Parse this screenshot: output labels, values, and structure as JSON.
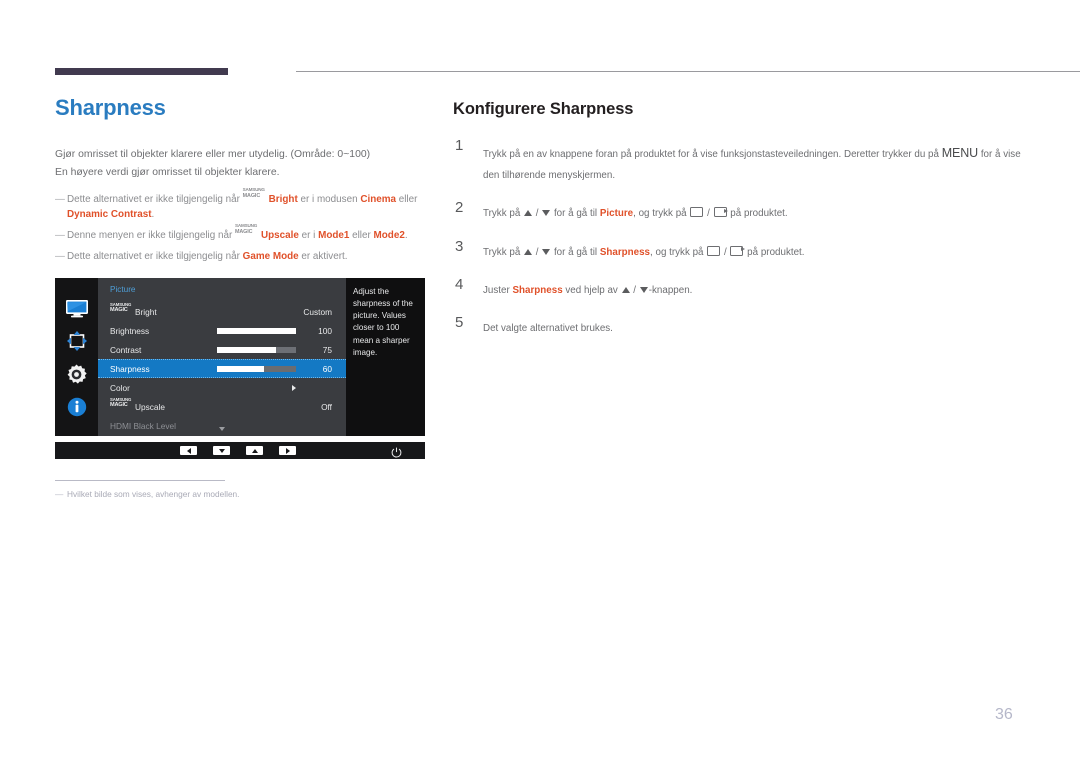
{
  "document": {
    "page_number": "36",
    "accent_blue": "#2a7cc0",
    "accent_orange": "#e0512a",
    "rule_color": "#413a4f"
  },
  "left": {
    "title": "Sharpness",
    "intro": [
      "Gjør omrisset til objekter klarere eller mer utydelig. (Område: 0~100)",
      "En høyere verdi gjør omrisset til objekter klarere."
    ],
    "notes": [
      {
        "dash": "—",
        "pre": "Dette alternativet er ikke tilgjengelig når ",
        "magic_top": "SAMSUNG",
        "magic_bottom": "MAGIC",
        "bold1": "Bright",
        "mid": " er i modusen ",
        "bold2": "Cinema",
        "mid2": " eller ",
        "bold3": "Dynamic Contrast",
        "post": "."
      },
      {
        "dash": "—",
        "pre": "Denne menyen er ikke tilgjengelig når ",
        "magic_top": "SAMSUNG",
        "magic_bottom": "MAGIC",
        "bold1": "Upscale",
        "mid": " er i ",
        "bold2": "Mode1",
        "mid2": " eller ",
        "bold3": "Mode2",
        "post": "."
      },
      {
        "dash": "—",
        "pre": "Dette alternativet er ikke tilgjengelig når ",
        "bold1": "Game Mode",
        "post": " er aktivert."
      }
    ],
    "footnote": {
      "dash": "—",
      "text": "Hvilket bilde som vises, avhenger av modellen."
    }
  },
  "osd": {
    "menu_title": "Picture",
    "side_icons": [
      {
        "name": "monitor-icon",
        "label": "Picture"
      },
      {
        "name": "resize-icon",
        "label": "OnScreen Display"
      },
      {
        "name": "gear-icon",
        "label": "System"
      },
      {
        "name": "info-icon",
        "label": "Information"
      }
    ],
    "rows": [
      {
        "label": "Bright",
        "magic_top": "SAMSUNG",
        "magic_bottom": "MAGIC",
        "has_magic": true,
        "value": "Custom",
        "type": "value",
        "selected": false,
        "disabled": false
      },
      {
        "label": "Brightness",
        "has_magic": false,
        "value": "100",
        "type": "slider",
        "fill_percent": 100,
        "selected": false,
        "disabled": false
      },
      {
        "label": "Contrast",
        "has_magic": false,
        "value": "75",
        "type": "slider",
        "fill_percent": 75,
        "selected": false,
        "disabled": false
      },
      {
        "label": "Sharpness",
        "has_magic": false,
        "value": "60",
        "type": "slider",
        "fill_percent": 60,
        "selected": true,
        "disabled": false
      },
      {
        "label": "Color",
        "has_magic": false,
        "value": "",
        "type": "submenu",
        "selected": false,
        "disabled": false
      },
      {
        "label": "Upscale",
        "magic_top": "SAMSUNG",
        "magic_bottom": "MAGIC",
        "has_magic": true,
        "value": "Off",
        "type": "value",
        "selected": false,
        "disabled": false
      },
      {
        "label": "HDMI Black Level",
        "has_magic": false,
        "value": "",
        "type": "value",
        "selected": false,
        "disabled": true
      }
    ],
    "help_text": "Adjust the sharpness of the picture. Values closer to 100 mean a sharper image.",
    "bottom_keys": [
      {
        "name": "key-left",
        "glyph": "left"
      },
      {
        "name": "key-down",
        "glyph": "down"
      },
      {
        "name": "key-up",
        "glyph": "up"
      },
      {
        "name": "key-right",
        "glyph": "right"
      },
      {
        "name": "key-power",
        "glyph": "power"
      }
    ]
  },
  "right": {
    "title": "Konfigurere Sharpness",
    "steps": [
      {
        "num": "1",
        "parts": [
          {
            "t": "text",
            "v": "Trykk på en av knappene foran på produktet for å vise funksjonstasteveiledningen. Deretter trykker du på "
          },
          {
            "t": "menu",
            "v": "MENU"
          },
          {
            "t": "text",
            "v": " for å vise den tilhørende menyskjermen."
          }
        ]
      },
      {
        "num": "2",
        "parts": [
          {
            "t": "text",
            "v": "Trykk på "
          },
          {
            "t": "icon",
            "v": "up"
          },
          {
            "t": "text",
            "v": " / "
          },
          {
            "t": "icon",
            "v": "down"
          },
          {
            "t": "text",
            "v": " for å gå til "
          },
          {
            "t": "bold",
            "v": "Picture"
          },
          {
            "t": "text",
            "v": ", og trykk på "
          },
          {
            "t": "icon",
            "v": "box"
          },
          {
            "t": "text",
            "v": " / "
          },
          {
            "t": "icon",
            "v": "enter"
          },
          {
            "t": "text",
            "v": " på produktet."
          }
        ]
      },
      {
        "num": "3",
        "parts": [
          {
            "t": "text",
            "v": "Trykk på "
          },
          {
            "t": "icon",
            "v": "up"
          },
          {
            "t": "text",
            "v": " / "
          },
          {
            "t": "icon",
            "v": "down"
          },
          {
            "t": "text",
            "v": " for å gå til "
          },
          {
            "t": "bold",
            "v": "Sharpness"
          },
          {
            "t": "text",
            "v": ", og trykk på "
          },
          {
            "t": "icon",
            "v": "box"
          },
          {
            "t": "text",
            "v": " / "
          },
          {
            "t": "icon",
            "v": "enter"
          },
          {
            "t": "text",
            "v": " på produktet."
          }
        ]
      },
      {
        "num": "4",
        "parts": [
          {
            "t": "text",
            "v": "Juster "
          },
          {
            "t": "bold",
            "v": "Sharpness"
          },
          {
            "t": "text",
            "v": " ved hjelp av "
          },
          {
            "t": "icon",
            "v": "up"
          },
          {
            "t": "text",
            "v": " / "
          },
          {
            "t": "icon",
            "v": "down"
          },
          {
            "t": "text",
            "v": "-knappen."
          }
        ]
      },
      {
        "num": "5",
        "parts": [
          {
            "t": "text",
            "v": "Det valgte alternativet brukes."
          }
        ]
      }
    ]
  }
}
